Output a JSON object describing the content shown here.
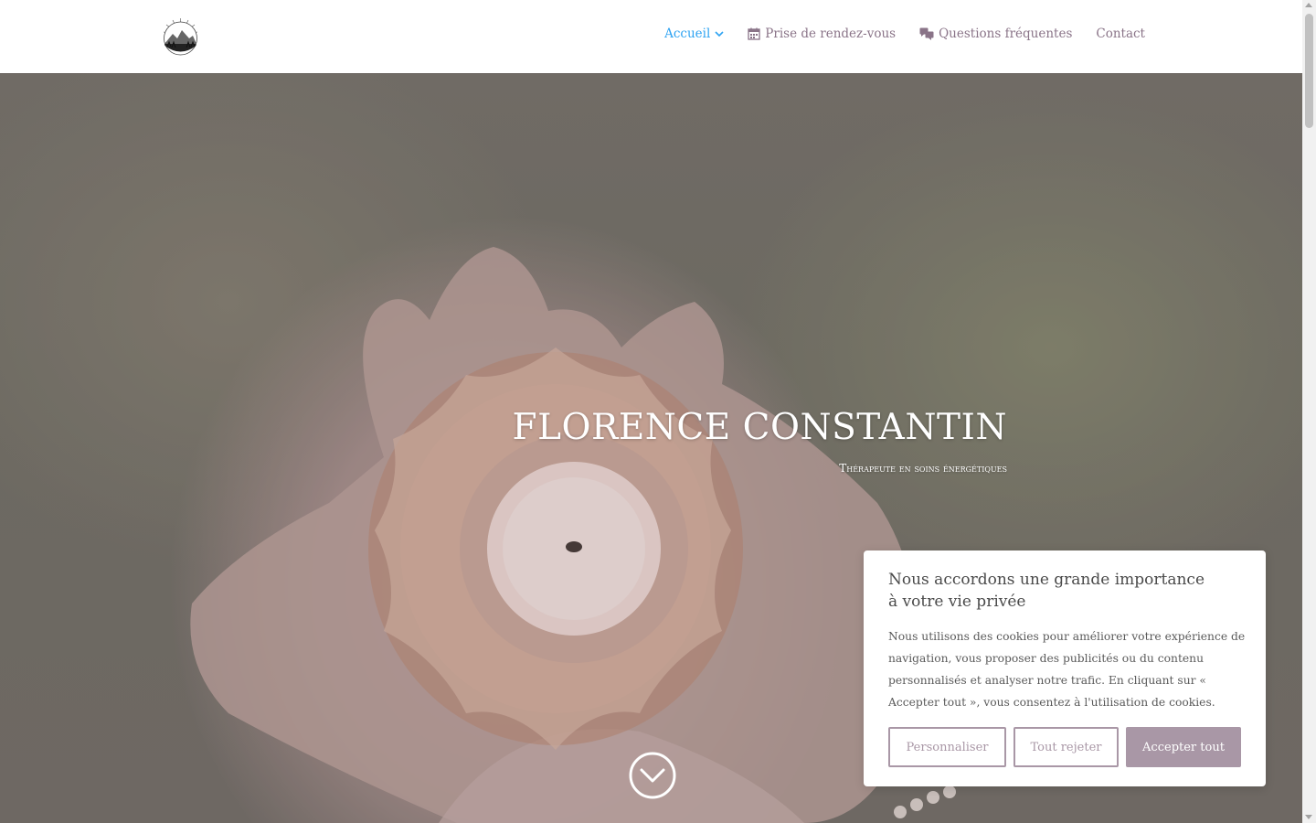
{
  "header": {
    "logo_icon": "mountain-sun-logo",
    "nav": [
      {
        "label": "Accueil",
        "icon": "chevron-down-icon",
        "active": true
      },
      {
        "label": "Prise de rendez-vous",
        "icon": "calendar-icon"
      },
      {
        "label": "Questions fréquentes",
        "icon": "chat-bubbles-icon"
      },
      {
        "label": "Contact"
      }
    ]
  },
  "hero": {
    "title": "FLORENCE CONSTANTIN",
    "subtitle": "Thérapeute en soins énergétiques",
    "scroll_icon": "chevron-circle-down-icon"
  },
  "cookie": {
    "title": "Nous accordons une grande importance à votre vie privée",
    "text": "Nous utilisons des cookies pour améliorer votre expérience de navigation, vous proposer des publicités ou du contenu personnalisés et analyser notre trafic. En cliquant sur « Accepter tout », vous consentez à l'utilisation de cookies.",
    "buttons": {
      "personalize": "Personnaliser",
      "reject": "Tout rejeter",
      "accept": "Accepter tout"
    }
  },
  "colors": {
    "accent": "#a997a6",
    "nav_text": "#8a7488",
    "nav_active": "#2ea3f2"
  }
}
